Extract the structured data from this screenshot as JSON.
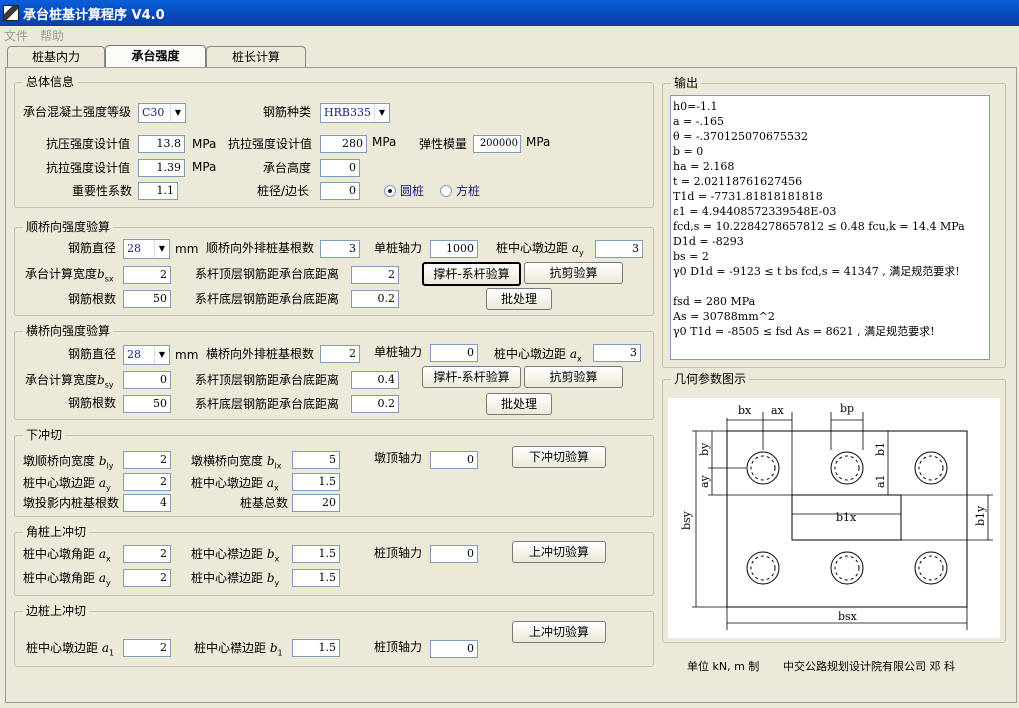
{
  "window": {
    "title": "承台桩基计算程序 V4.0"
  },
  "menu": [
    "文件",
    "帮助"
  ],
  "tabs": [
    "桩基内力",
    "承台强度",
    "桩长计算"
  ],
  "general": {
    "legend": "总体信息",
    "concrete_grade_label": "承台混凝土强度等级",
    "concrete_grade": "C30",
    "rebar_type_label": "钢筋种类",
    "rebar_type": "HRB335",
    "comp_strength_label": "抗压强度设计值",
    "comp_strength": "13.8",
    "rebar_strength_label": "抗拉强度设计值",
    "rebar_strength": "280",
    "modulus_label": "弹性模量",
    "modulus": "200000",
    "tensile_label": "抗拉强度设计值",
    "tensile": "1.39",
    "height_label": "承台高度",
    "height": "0",
    "importance_label": "重要性系数",
    "importance": "1.1",
    "diameter_label": "桩径/边长",
    "diameter": "0",
    "round_pile": "圆桩",
    "square_pile": "方桩",
    "unit_mpa": "MPa"
  },
  "longitudinal": {
    "legend": "顺桥向强度验算",
    "rebar_dia_label": "钢筋直径",
    "rebar_dia": "28",
    "mm": "mm",
    "outer_row_label": "顺桥向外排桩基根数",
    "outer_row": "3",
    "axial_label": "单桩轴力",
    "axial": "1000",
    "edge_label": "桩中心墩边距",
    "edge_sym": "a",
    "edge_sub": "y",
    "edge": "3",
    "width_label": "承台计算宽度",
    "width_sym": "b",
    "width_sub": "sx",
    "width": "2",
    "top_dist_label": "系杆顶层钢筋距承台底距离",
    "top_dist": "2",
    "count_label": "钢筋根数",
    "count": "50",
    "bottom_dist_label": "系杆底层钢筋距承台底距离",
    "bottom_dist": "0.2",
    "strut_btn": "撑杆-系杆验算",
    "shear_btn": "抗剪验算",
    "batch_btn": "批处理"
  },
  "transverse": {
    "legend": "横桥向强度验算",
    "rebar_dia_label": "钢筋直径",
    "rebar_dia": "28",
    "mm": "mm",
    "outer_row_label": "横桥向外排桩基根数",
    "outer_row": "2",
    "axial_label": "单桩轴力",
    "axial": "0",
    "edge_label": "桩中心墩边距",
    "edge_sym": "a",
    "edge_sub": "x",
    "edge": "3",
    "width_label": "承台计算宽度",
    "width_sym": "b",
    "width_sub": "sy",
    "width": "0",
    "top_dist_label": "系杆顶层钢筋距承台底距离",
    "top_dist": "0.4",
    "count_label": "钢筋根数",
    "count": "50",
    "bottom_dist_label": "系杆底层钢筋距承台底距离",
    "bottom_dist": "0.2",
    "strut_btn": "撑杆-系杆验算",
    "shear_btn": "抗剪验算",
    "batch_btn": "批处理"
  },
  "punch_down": {
    "legend": "下冲切",
    "b_ly_label": "墩顺桥向宽度",
    "b_ly_sym": "b",
    "b_ly_sub": "ly",
    "b_ly": "2",
    "b_lx_label": "墩横桥向宽度",
    "b_lx_sym": "b",
    "b_lx_sub": "lx",
    "b_lx": "5",
    "top_axial_label": "墩顶轴力",
    "top_axial": "0",
    "btn": "下冲切验算",
    "a_y_label": "桩中心墩边距",
    "a_y_sym": "a",
    "a_y_sub": "y",
    "a_y": "2",
    "a_x_label": "桩中心墩边距",
    "a_x_sym": "a",
    "a_x_sub": "x",
    "a_x": "1.5",
    "inner_label": "墩投影内桩基根数",
    "inner": "4",
    "total_label": "桩基总数",
    "total": "20"
  },
  "corner_punch": {
    "legend": "角桩上冲切",
    "a_x_label": "桩中心墩角距",
    "a_x_sym": "a",
    "a_x_sub": "x",
    "a_x": "2",
    "b_x_label": "桩中心襟边距",
    "b_x_sym": "b",
    "b_x_sub": "x",
    "b_x": "1.5",
    "axial_label": "桩顶轴力",
    "axial": "0",
    "btn": "上冲切验算",
    "a_y_label": "桩中心墩角距",
    "a_y_sym": "a",
    "a_y_sub": "y",
    "a_y": "2",
    "b_y_label": "桩中心襟边距",
    "b_y_sym": "b",
    "b_y_sub": "y",
    "b_y": "1.5"
  },
  "edge_punch": {
    "legend": "边桩上冲切",
    "btn": "上冲切验算",
    "a1_label": "桩中心墩边距",
    "a1_sym": "a",
    "a1_sub": "1",
    "a1": "2",
    "b1_label": "桩中心襟边距",
    "b1_sym": "b",
    "b1_sub": "1",
    "b1": "1.5",
    "axial_label": "桩顶轴力",
    "axial": "0"
  },
  "output": {
    "legend": "输出",
    "lines": [
      "h0=-1.1",
      "a = -.165",
      "θ = -.370125070675532",
      "b = 0",
      "ha = 2.168",
      "t = 2.02118761627456",
      "T1d = -7731.81818181818",
      "ε1 = 4.94408572339548E-03",
      "fcd,s = 10.2284278657812 ≤ 0.48 fcu,k = 14.4 MPa",
      "D1d = -8293",
      "bs = 2",
      "γ0 D1d = -9123 ≤ t bs fcd,s = 41347 , 满足规范要求!",
      "",
      "fsd = 280 MPa",
      "As = 30788mm^2",
      "γ0 T1d = -8505 ≤ fsd As = 8621 , 满足规范要求!"
    ]
  },
  "geometry": {
    "legend": "几何参数图示",
    "labels": [
      "bx",
      "ax",
      "bp",
      "by",
      "ay",
      "b1",
      "a1",
      "b1x",
      "b1y",
      "bsy",
      "bsx"
    ]
  },
  "footer": {
    "units": "单位  kN, m 制",
    "company": "中交公路规划设计院有限公司  邓    科"
  }
}
